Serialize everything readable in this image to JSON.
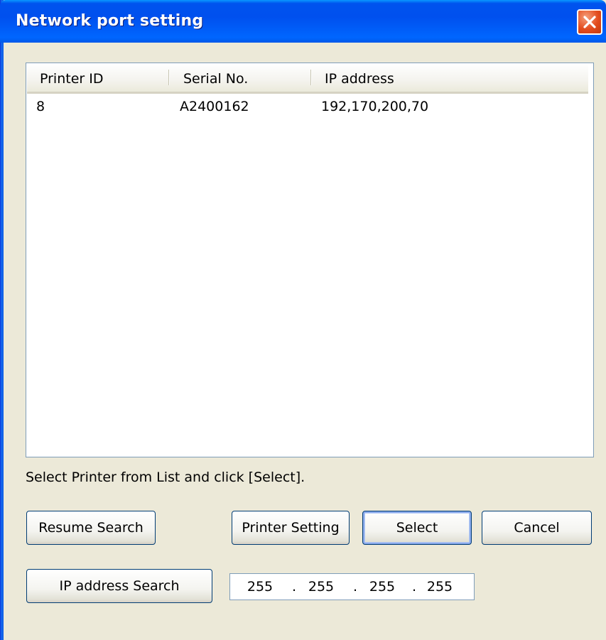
{
  "window": {
    "title": "Network port setting"
  },
  "list": {
    "columns": [
      "Printer ID",
      "Serial No.",
      "IP address"
    ],
    "rows": [
      {
        "printer_id": "8",
        "serial_no": "A2400162",
        "ip_address": "192,170,200,70"
      }
    ]
  },
  "instruction": "Select Printer from List and click [Select].",
  "buttons": {
    "resume_search": "Resume Search",
    "printer_setting": "Printer Setting",
    "select": "Select",
    "cancel": "Cancel",
    "ip_address_search": "IP address Search"
  },
  "ip_input": {
    "octets": [
      "255",
      "255",
      "255",
      "255"
    ],
    "separator": "."
  },
  "icons": {
    "close": "close-icon"
  },
  "colors": {
    "titlebar": "#0054E3",
    "window_bg": "#ECE9D8",
    "close_button": "#E34C1D",
    "border": "#7F9DB9"
  }
}
